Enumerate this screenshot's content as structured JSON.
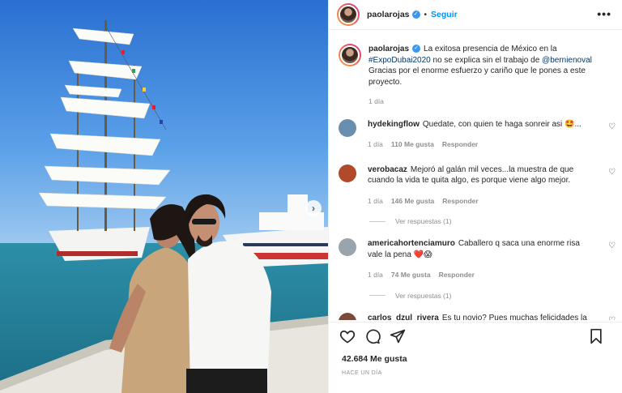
{
  "header": {
    "username": "paolarojas",
    "follow_label": "Seguir",
    "more_label": "•••"
  },
  "caption": {
    "username": "paolarojas",
    "text_1": "La exitosa presencia de México en la ",
    "hashtag": "#ExpoDubai2020",
    "text_2": " no se explica sin el trabajo de ",
    "mention": "@bernienoval",
    "text_3": " Gracias por el enorme esfuerzo y cariño que le pones a este proyecto.",
    "time": "1 día"
  },
  "comments": [
    {
      "username": "hydekingflow",
      "text": "Quedate, con quien te haga sonreir asi 🤩...",
      "time": "1 día",
      "likes": "110 Me gusta",
      "reply": "Responder",
      "avatar_color": "#6a8fae"
    },
    {
      "username": "verobacaz",
      "text": "Mejoró al galán mil veces...la muestra de que cuando la vida te quita algo, es porque viene algo mejor.",
      "time": "1 día",
      "likes": "146 Me gusta",
      "reply": "Responder",
      "view_replies": "Ver respuestas (1)",
      "avatar_color": "#b04a2a"
    },
    {
      "username": "americahortenciamuro",
      "text": "Caballero q saca una enorme risa vale la pena ❤️😱",
      "time": "1 día",
      "likes": "74 Me gusta",
      "reply": "Responder",
      "view_replies": "Ver respuestas (1)",
      "avatar_color": "#9aa4ad"
    },
    {
      "username": "carlos_dzul_rivera",
      "text": "Es tu novio? Pues muchas felicidades la",
      "avatar_color": "#7a4a3a"
    }
  ],
  "footer": {
    "likes": "42.684 Me gusta",
    "time": "HACE UN DÍA"
  },
  "colors": {
    "accent": "#0095f6",
    "verified": "#3897f0",
    "muted": "#8e8e8e"
  }
}
